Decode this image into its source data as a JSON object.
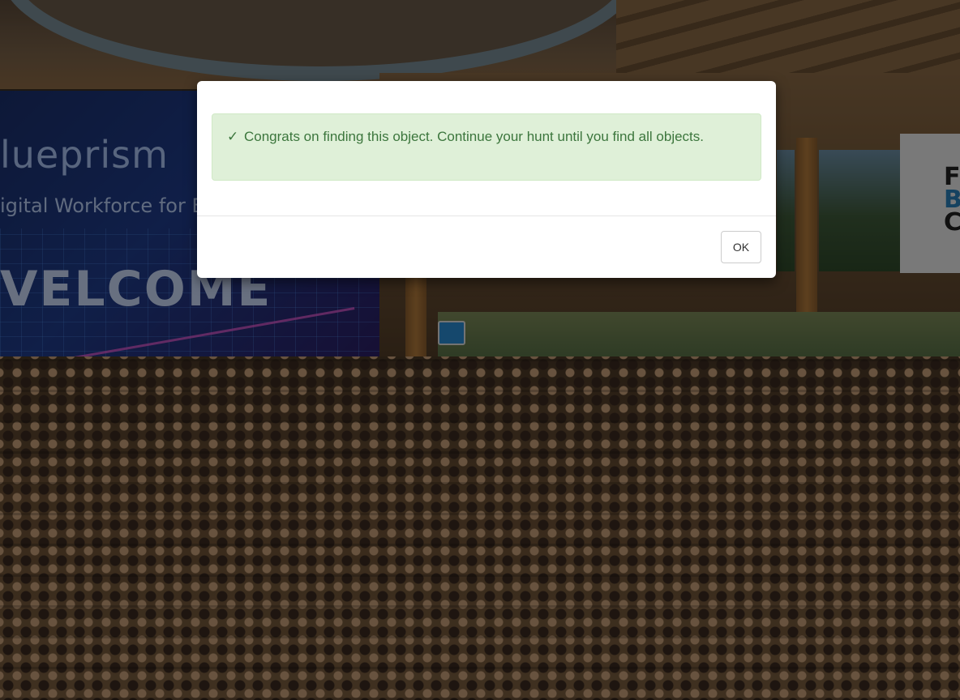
{
  "background": {
    "banner": {
      "brand": "lueprism",
      "tagline": "igital Workforce for E",
      "headline": "VELCOME"
    },
    "right_sign": [
      "F",
      "B",
      "C"
    ],
    "colors": {
      "banner_blue": "#1f3c8a",
      "wood": "#8a6a45",
      "right_sign_accent": "#2a7fb8"
    }
  },
  "modal": {
    "alert": {
      "icon": "check-icon",
      "icon_glyph": "✓",
      "message": "Congrats on finding this object. Continue your hunt until you find all objects.",
      "colors": {
        "background": "#dff0d8",
        "text": "#3c763d",
        "border": "#d0e9c6"
      }
    },
    "ok_label": "OK"
  }
}
